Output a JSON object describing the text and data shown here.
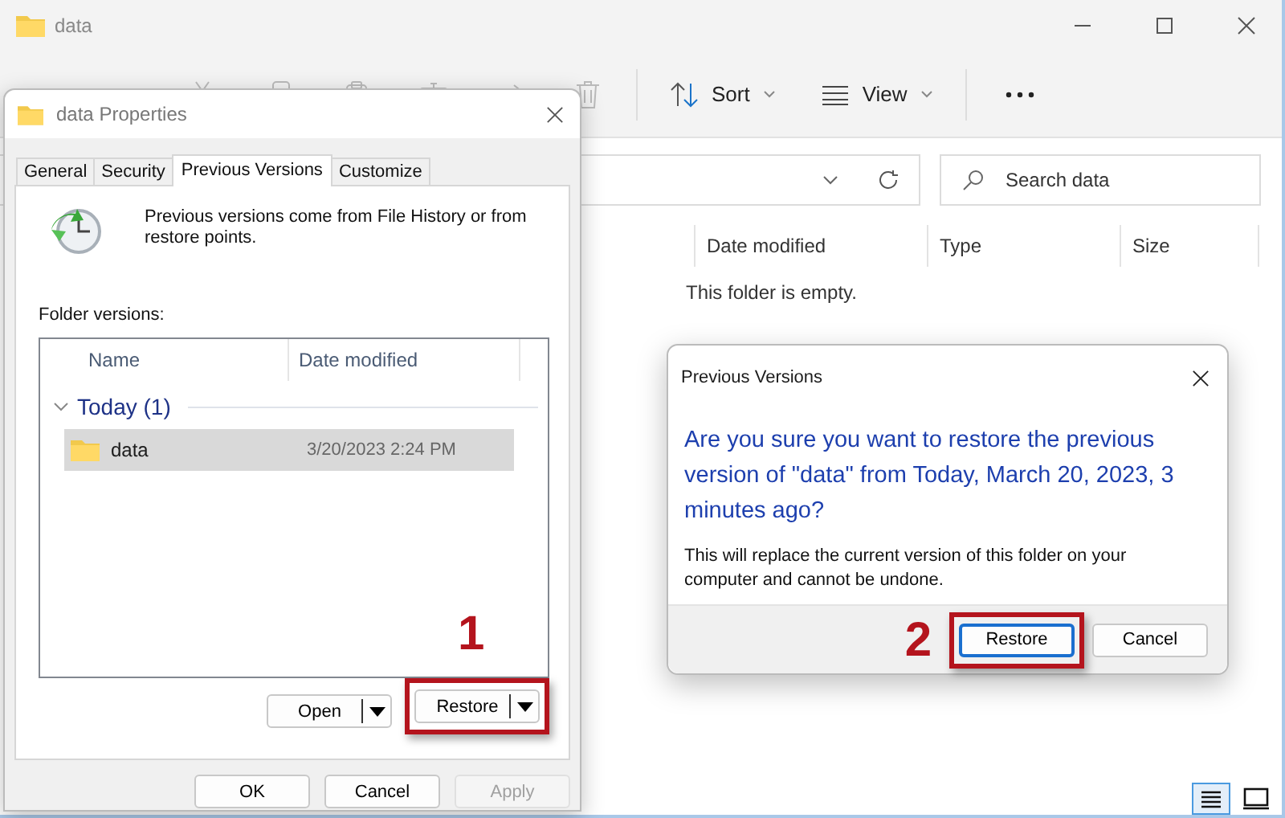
{
  "explorer": {
    "title": "data",
    "toolbar": [
      {
        "kind": "cut",
        "disabled": true
      },
      {
        "kind": "copy",
        "disabled": true
      },
      {
        "kind": "paste",
        "disabled": true
      },
      {
        "kind": "rename",
        "disabled": true
      },
      {
        "kind": "share",
        "disabled": true
      },
      {
        "kind": "delete",
        "disabled": true
      }
    ],
    "sort": "Sort",
    "view": "View",
    "search": {
      "placeholder": "Search data"
    },
    "columns": [
      "Date modified",
      "Type",
      "Size"
    ],
    "empty_text": "This folder is empty.",
    "view_modes": [
      {
        "kind": "details",
        "selected": true
      },
      {
        "kind": "tiles",
        "selected": false
      }
    ]
  },
  "properties": {
    "title": "data Properties",
    "tabs": [
      {
        "label": "General",
        "selected": false
      },
      {
        "label": "Security",
        "selected": false
      },
      {
        "label": "Previous Versions",
        "selected": true
      },
      {
        "label": "Customize",
        "selected": false
      }
    ],
    "info": "Previous versions come from File History or from restore points.",
    "list_label": "Folder versions:",
    "columns": [
      "Name",
      "Date modified"
    ],
    "groups": [
      {
        "label": "Today (1)",
        "expanded": true,
        "items": [
          {
            "name": "data",
            "date": "3/20/2023 2:24 PM",
            "selected": true
          }
        ]
      }
    ],
    "buttons": [
      {
        "label": "Open"
      },
      {
        "label": "Restore",
        "callout": "1"
      }
    ],
    "footer_buttons": [
      {
        "label": "OK",
        "disabled": false
      },
      {
        "label": "Cancel",
        "disabled": false
      },
      {
        "label": "Apply",
        "disabled": true
      }
    ]
  },
  "confirm": {
    "title": "Previous Versions",
    "question": "Are you sure you want to restore the previous version of \"data\" from Today, March 20, 2023, 3 minutes ago?",
    "note": "This will replace the current version of this folder on your computer and cannot be undone.",
    "buttons": [
      {
        "label": "Restore",
        "default": true,
        "callout": "2"
      },
      {
        "label": "Cancel",
        "default": false
      }
    ]
  }
}
